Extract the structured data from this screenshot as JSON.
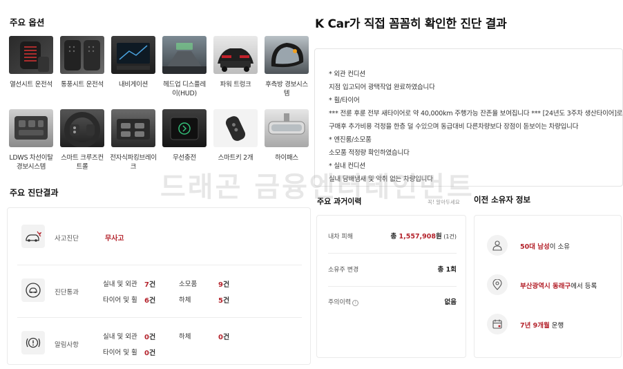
{
  "options": {
    "title": "주요 옵션",
    "items": [
      {
        "label": "열선시트 운전석",
        "icon": "heated-seat-icon"
      },
      {
        "label": "통풍시트 운전석",
        "icon": "ventilated-seat-icon"
      },
      {
        "label": "내비게이션",
        "icon": "navigation-icon"
      },
      {
        "label": "헤드업 디스플레이(HUD)",
        "icon": "hud-icon"
      },
      {
        "label": "파워 트렁크",
        "icon": "power-trunk-icon"
      },
      {
        "label": "후측방 경보시스템",
        "icon": "blind-spot-mirror-icon"
      },
      {
        "label": "LDWS 차선이탈 경보시스템",
        "icon": "lane-departure-icon"
      },
      {
        "label": "스마트 크루즈컨트롤",
        "icon": "smart-cruise-icon"
      },
      {
        "label": "전자식파킹브레이크",
        "icon": "electronic-parking-brake-icon"
      },
      {
        "label": "무선충전",
        "icon": "wireless-charging-icon"
      },
      {
        "label": "스마트키 2개",
        "icon": "smart-key-icon"
      },
      {
        "label": "하이패스",
        "icon": "hipass-mirror-icon"
      }
    ]
  },
  "diagnosis": {
    "title": "K Car가 직접 꼼꼼히 확인한 진단 결과",
    "lines": [
      "* 외관 컨디션",
      "지점 입고되어 광택작업 완료하였습니다",
      "* 휠/타이어",
      "*** 전륜 후륜 전부 새타이어로 약 40,000km 주행가능 잔존율 보여집니다 *** [24년도 3주차 생산타이어]로",
      "구매후 추가비용 걱정을 한층 덜 수있으며 동급대비 다른차량보다 장점이 돋보이는 차량입니다",
      "* 엔진룸/소모품",
      "소모품 적정량 확인하였습니다",
      "* 실내 컨디션",
      "실내 담배냄새 및 악취 없는 차량입니다"
    ]
  },
  "watermark": "드래곤 금융엔터테인먼트",
  "main_result": {
    "title": "주요 진단결과",
    "accident": {
      "name": "사고진단",
      "value": "무사고",
      "icon": "car-crash-icon"
    },
    "passed": {
      "name": "진단통과",
      "icon": "car-check-icon",
      "cells": [
        {
          "label": "실내 및 외관",
          "count": "7",
          "unit": "건"
        },
        {
          "label": "소모품",
          "count": "9",
          "unit": "건"
        },
        {
          "label": "타이어 및 휠",
          "count": "6",
          "unit": "건"
        },
        {
          "label": "하체",
          "count": "5",
          "unit": "건"
        }
      ]
    },
    "notice": {
      "name": "알림사항",
      "icon": "brake-warning-icon",
      "cells": [
        {
          "label": "실내 및 외관",
          "count": "0",
          "unit": "건"
        },
        {
          "label": "하체",
          "count": "0",
          "unit": "건"
        },
        {
          "label": "타이어 및 휠",
          "count": "0",
          "unit": "건"
        }
      ]
    }
  },
  "history": {
    "title": "주요 과거이력",
    "note": "꼭! 알아두세요",
    "rows": [
      {
        "label": "내차 피해",
        "value_prefix": "총 ",
        "value_red": "1,557,908",
        "value_suffix": "원",
        "value_small": " (1건)"
      },
      {
        "label": "소유주 변경",
        "value_prefix": "총 ",
        "value_red": "",
        "value_suffix": "1회",
        "value_small": ""
      },
      {
        "label": "주의이력",
        "value_prefix": "",
        "value_red": "",
        "value_suffix": "없음",
        "value_small": ""
      }
    ]
  },
  "owner": {
    "title": "이전 소유자 정보",
    "rows": [
      {
        "red": "50대 남성",
        "rest": "이 소유",
        "icon": "person-icon"
      },
      {
        "red": "부산광역시 동래구",
        "rest": "에서 등록",
        "icon": "location-pin-icon"
      },
      {
        "red": "7년 9개월",
        "rest": " 운행",
        "icon": "calendar-icon"
      }
    ]
  },
  "colors": {
    "accent_red": "#b4232c",
    "border": "#eaeaea",
    "icon_bg": "#f2f2f2"
  }
}
